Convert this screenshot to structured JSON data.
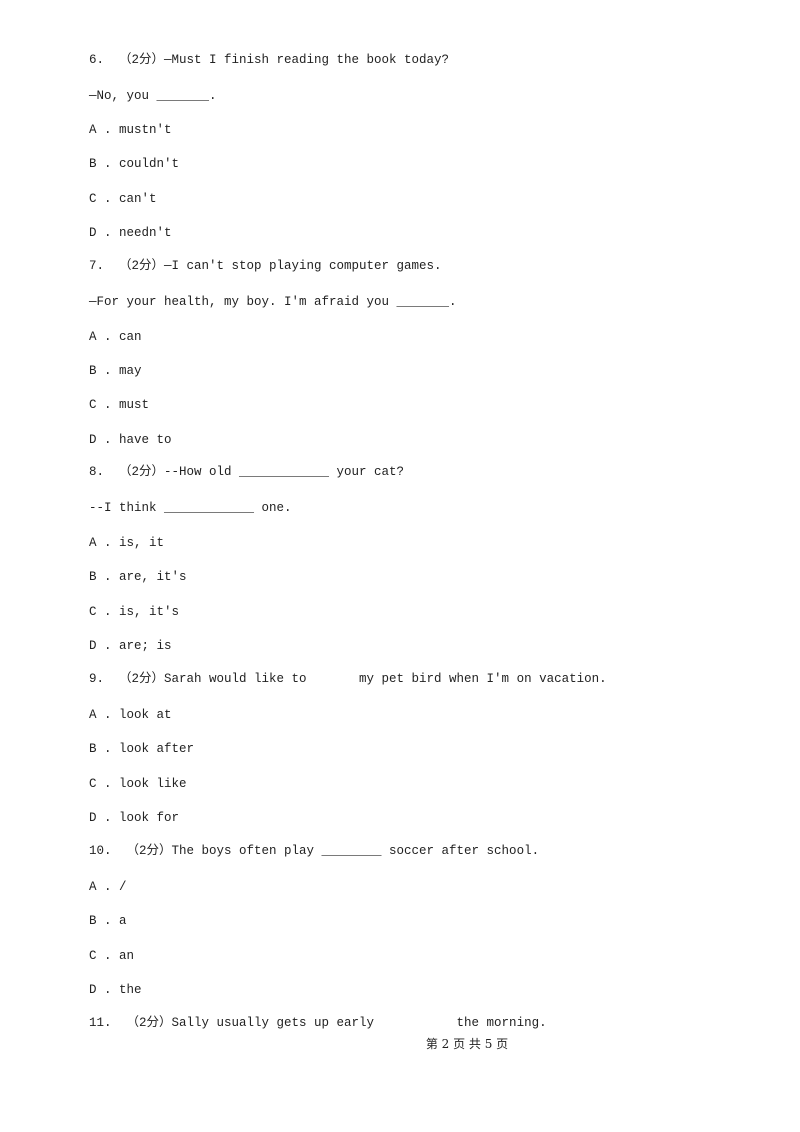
{
  "questions": [
    {
      "stem": "6.  （2分）—Must I finish reading the book today?",
      "stem2": "—No, you _______.",
      "options": [
        "A . mustn't",
        "B . couldn't",
        "C . can't",
        "D . needn't"
      ]
    },
    {
      "stem": "7.  （2分）—I can't stop playing computer games.",
      "stem2": "—For your health, my boy. I'm afraid you _______.",
      "options": [
        "A . can",
        "B . may",
        "C . must",
        "D . have to"
      ]
    },
    {
      "stem": "8.  （2分）--How old ____________ your cat?",
      "stem2": "--I think ____________ one.",
      "options": [
        "A . is, it",
        "B . are, it's",
        "C . is, it's",
        "D . are; is"
      ]
    },
    {
      "stem": "9.  （2分）Sarah would like to       my pet bird when I'm on vacation.",
      "options": [
        "A . look at",
        "B . look after",
        "C . look like",
        "D . look for"
      ]
    },
    {
      "stem": "10.  （2分）The boys often play ________ soccer after school.",
      "options": [
        "A . /",
        "B . a",
        "C . an",
        "D . the"
      ]
    },
    {
      "stem": "11.  （2分）Sally usually gets up early           the morning."
    }
  ],
  "footer": "第 2 页 共 5 页"
}
